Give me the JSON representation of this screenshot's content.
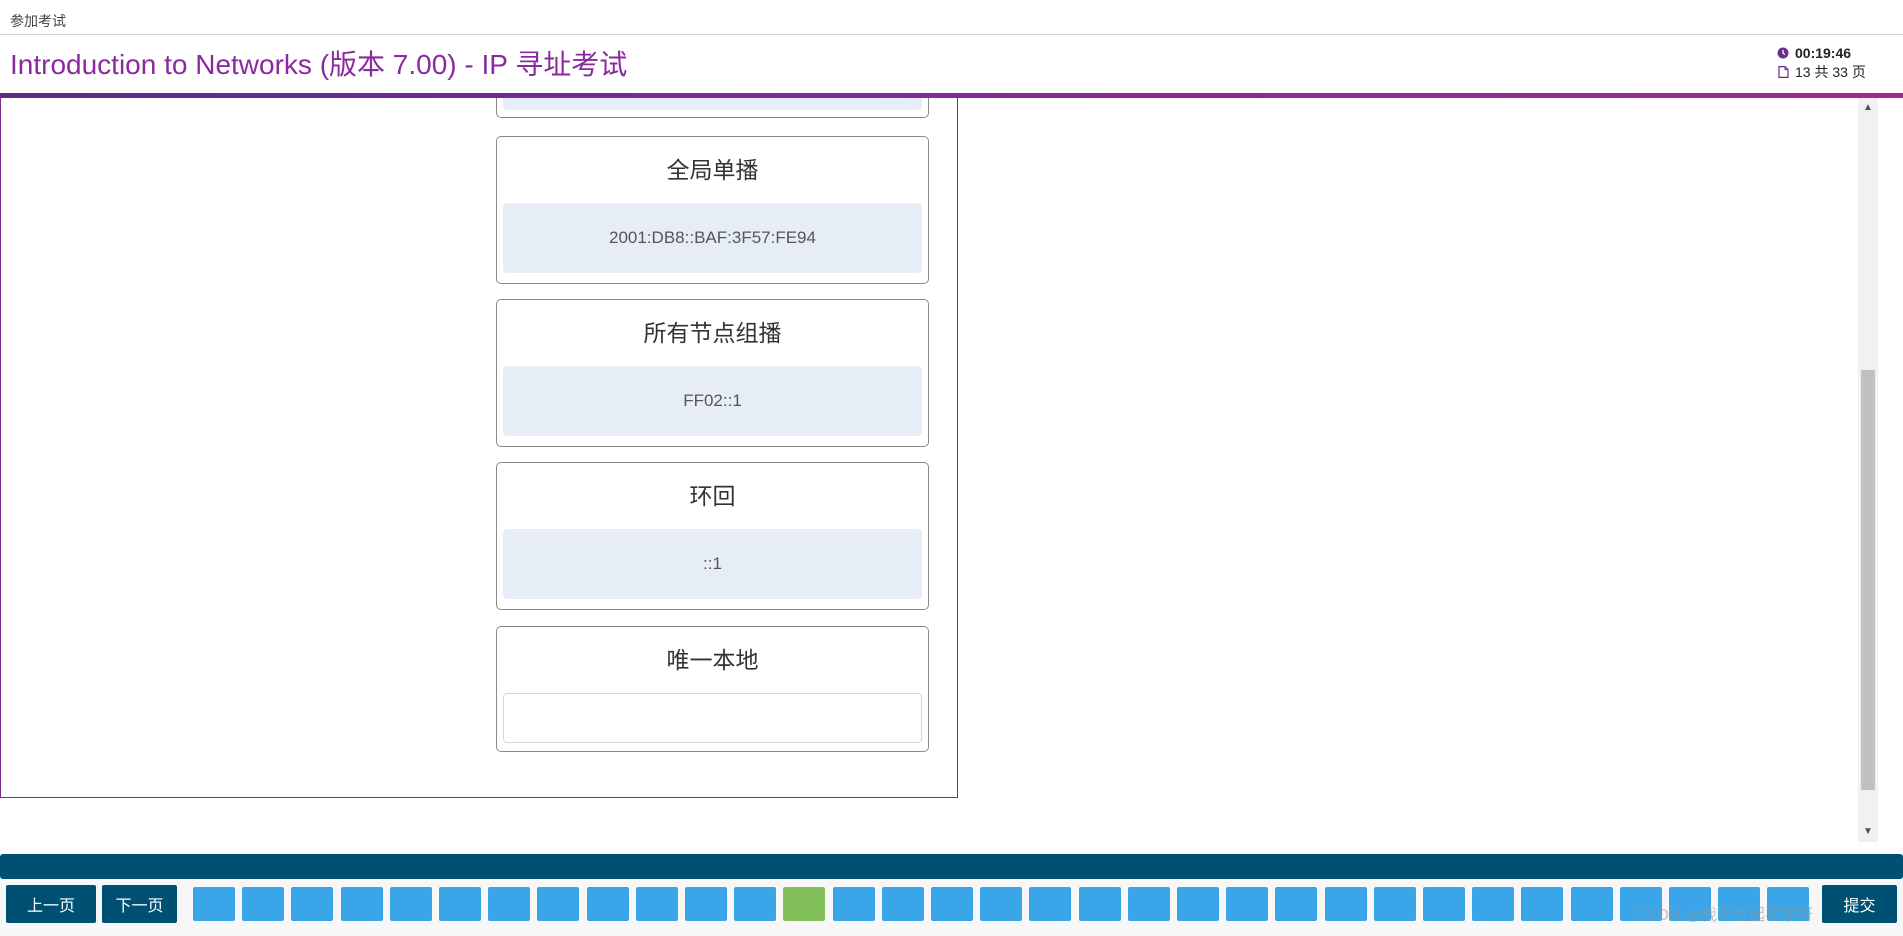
{
  "top": {
    "label": "参加考试"
  },
  "header": {
    "title": "Introduction to Networks (版本 7.00) - IP 寻址考试",
    "timer": "00:19:46",
    "page_status": "13 共 33 页"
  },
  "cards": [
    {
      "title": "全局单播",
      "answer": "2001:DB8::BAF:3F57:FE94"
    },
    {
      "title": "所有节点组播",
      "answer": "FF02::1"
    },
    {
      "title": "环回",
      "answer": "::1"
    },
    {
      "title": "唯一本地",
      "answer": ""
    }
  ],
  "footer": {
    "prev_label": "上一页",
    "next_label": "下一页",
    "submit_label": "提交",
    "page_count": 33,
    "current_page": 13
  },
  "watermark": "CSDN @我不会起名字呀",
  "colors": {
    "brand": "#005073",
    "page_btn": "#3aa6e9",
    "current_page": "#84c05a",
    "title": "#8b2aa0"
  }
}
